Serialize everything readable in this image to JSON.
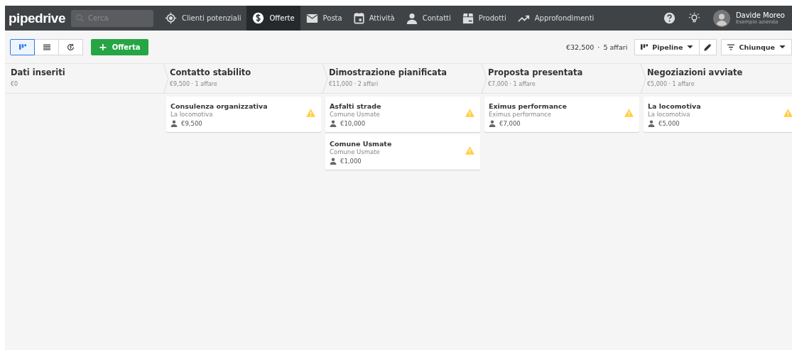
{
  "brand": "pipedrive",
  "search": {
    "placeholder": "Cerca"
  },
  "nav": [
    {
      "label": "Clienti potenziali",
      "selected": false
    },
    {
      "label": "Offerte",
      "selected": true
    },
    {
      "label": "Posta",
      "selected": false
    },
    {
      "label": "Attività",
      "selected": false
    },
    {
      "label": "Contatti",
      "selected": false
    },
    {
      "label": "Prodotti",
      "selected": false
    },
    {
      "label": "Approfondimenti",
      "selected": false
    }
  ],
  "user": {
    "name": "Davide Moreo",
    "company": "Esempio azienda"
  },
  "views": [
    {
      "selected": true
    },
    {
      "selected": false
    },
    {
      "selected": false
    }
  ],
  "add_button": {
    "icon": "+",
    "label": "Offerta"
  },
  "summary": {
    "total": "€32,500",
    "separator": "·",
    "count": "5 affari"
  },
  "pipeline_button": "Pipeline",
  "filter_button": "Chiunque",
  "stages": [
    {
      "title": "Dati inseriti",
      "summary": "€0"
    },
    {
      "title": "Contatto stabilito",
      "summary": "€9,500 · 1 affare",
      "deals": [
        {
          "title": "Consulenza organizzativa",
          "org": "La locomotiva",
          "value": "€9,500",
          "warning": true
        }
      ]
    },
    {
      "title": "Dimostrazione pianificata",
      "summary": "€11,000 · 2 affari",
      "deals": [
        {
          "title": "Asfalti strade",
          "org": "Comune Usmate",
          "value": "€10,000",
          "warning": true
        },
        {
          "title": "Comune Usmate",
          "org": "Comune Usmate",
          "value": "€1,000",
          "warning": true
        }
      ]
    },
    {
      "title": "Proposta presentata",
      "summary": "€7,000 · 1 affare",
      "deals": [
        {
          "title": "Eximus performance",
          "org": "Eximus performance",
          "value": "€7,000",
          "warning": true
        }
      ]
    },
    {
      "title": "Negoziazioni avviate",
      "summary": "€5,000 · 1 affare",
      "deals": [
        {
          "title": "La locomotiva",
          "org": "La locomotiva",
          "value": "€5,000",
          "warning": true
        }
      ]
    }
  ]
}
